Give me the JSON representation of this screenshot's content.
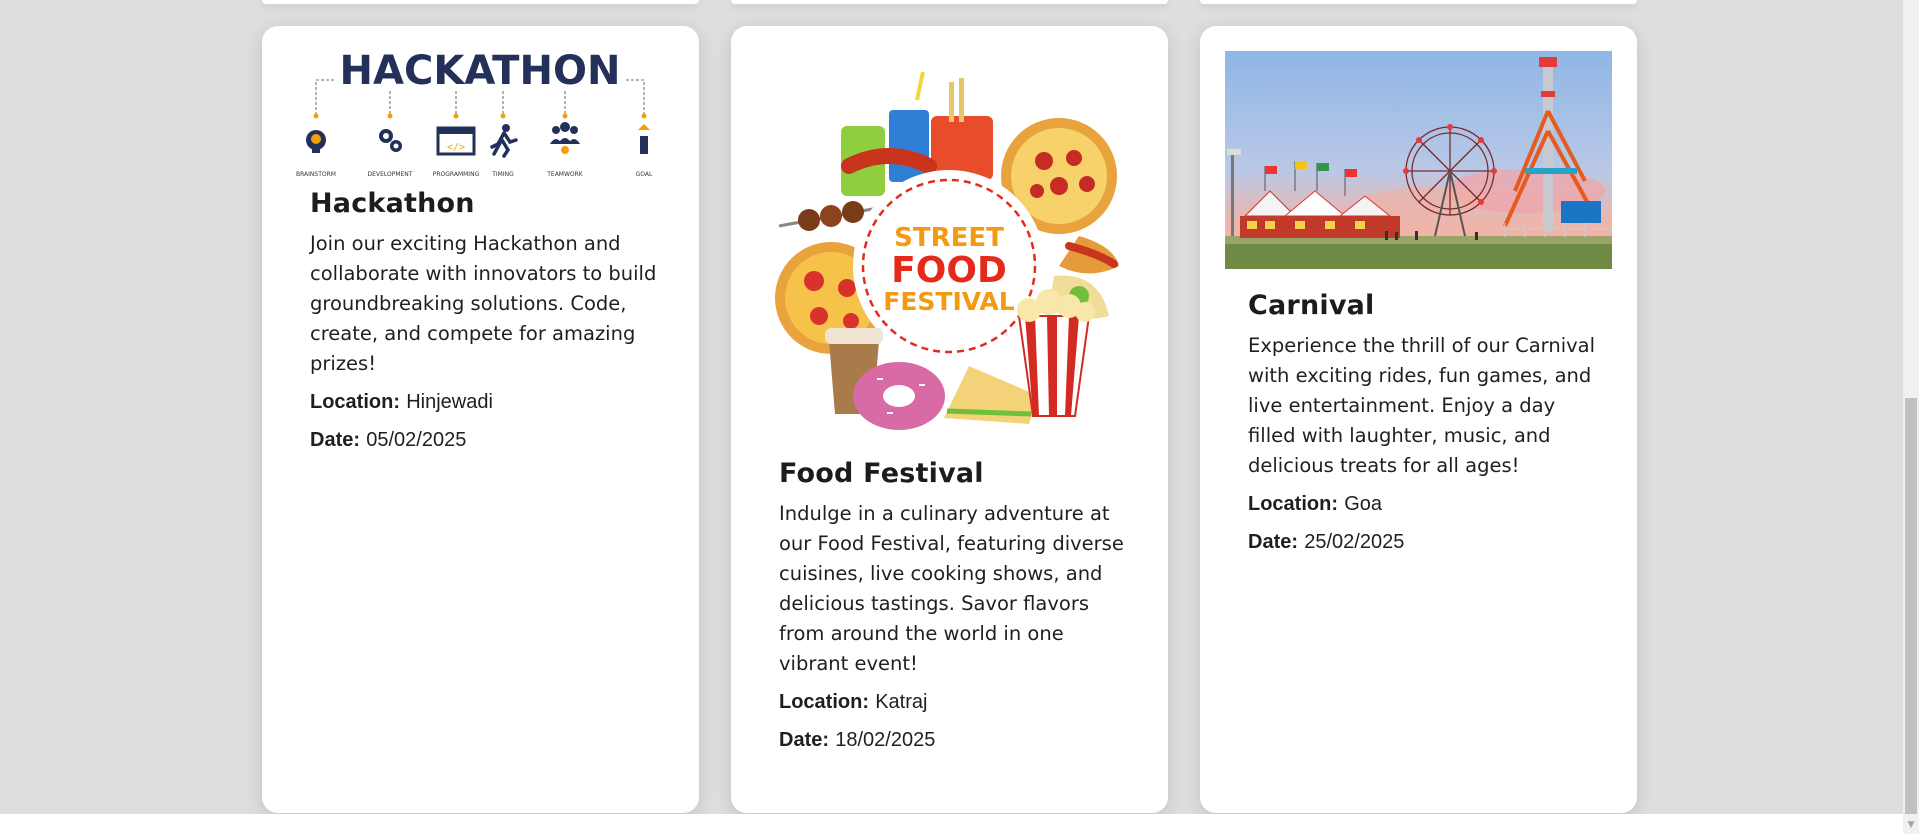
{
  "events": [
    {
      "title": "Hackathon",
      "description": "Join our exciting Hackathon and collaborate with innovators to build groundbreaking solutions. Code, create, and compete for amazing prizes!",
      "location_label": "Location:",
      "location": "Hinjewadi",
      "date_label": "Date:",
      "date": "05/02/2025",
      "image": {
        "banner": "HACKATHON",
        "steps": [
          "BRAINSTORM",
          "DEVELOPMENT",
          "PROGRAMMING",
          "TIMING",
          "TEAMWORK",
          "GOAL"
        ],
        "colors": {
          "navy": "#22305a",
          "gold": "#f2a007"
        }
      }
    },
    {
      "title": "Food Festival",
      "description": "Indulge in a culinary adventure at our Food Festival, featuring diverse cuisines, live cooking shows, and delicious tastings. Savor flavors from around the world in one vibrant event!",
      "location_label": "Location:",
      "location": "Katraj",
      "date_label": "Date:",
      "date": "18/02/2025",
      "image": {
        "line1": "STREET",
        "line2": "FOOD",
        "line3": "FESTIVAL",
        "colors": {
          "orange": "#f39a12",
          "red": "#e52a1c"
        }
      }
    },
    {
      "title": "Carnival",
      "description": "Experience the thrill of our Carnival with exciting rides, fun games, and live entertainment. Enjoy a day filled with laughter, music, and delicious treats for all ages!",
      "location_label": "Location:",
      "location": "Goa",
      "date_label": "Date:",
      "date": "25/02/2025",
      "image": {
        "icon": "carnival-photo"
      }
    }
  ]
}
